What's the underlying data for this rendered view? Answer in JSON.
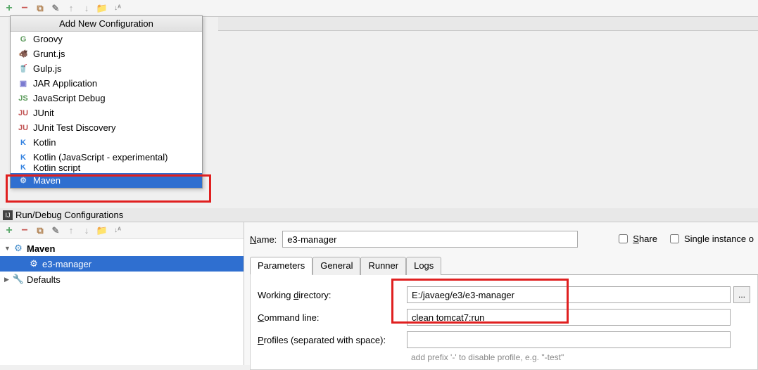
{
  "topToolbar": {
    "add": "+",
    "remove": "−",
    "copy": "⧉",
    "wrench": "✎",
    "up": "↑",
    "down": "↓",
    "folder": "📁",
    "sort": "↓ᴬ"
  },
  "dropdown": {
    "header": "Add New Configuration",
    "items": [
      {
        "icon": "G",
        "cls": "icon-g",
        "label": "Groovy"
      },
      {
        "icon": "🐗",
        "cls": "icon-grunt",
        "label": "Grunt.js"
      },
      {
        "icon": "🥤",
        "cls": "icon-gulp",
        "label": "Gulp.js"
      },
      {
        "icon": "▣",
        "cls": "icon-jar",
        "label": "JAR Application"
      },
      {
        "icon": "JS",
        "cls": "icon-js",
        "label": "JavaScript Debug"
      },
      {
        "icon": "JU",
        "cls": "icon-junit",
        "label": "JUnit"
      },
      {
        "icon": "JU",
        "cls": "icon-junit",
        "label": "JUnit Test Discovery"
      },
      {
        "icon": "K",
        "cls": "icon-k",
        "label": "Kotlin"
      },
      {
        "icon": "K",
        "cls": "icon-k",
        "label": "Kotlin (JavaScript - experimental)"
      },
      {
        "icon": "K",
        "cls": "icon-k",
        "label": "Kotlin script",
        "cutoff": true
      },
      {
        "icon": "⚙",
        "cls": "icon-maven",
        "label": "Maven",
        "selected": true
      }
    ]
  },
  "panelTitle": "Run/Debug Configurations",
  "tree": {
    "maven": "Maven",
    "child": "e3-manager",
    "defaults": "Defaults"
  },
  "form": {
    "nameLabel": "Name:",
    "nameValue": "e3-manager",
    "share": "Share",
    "single": "Single instance o",
    "tabs": [
      "Parameters",
      "General",
      "Runner",
      "Logs"
    ],
    "workdirLabel": "Working directory:",
    "workdirValue": "E:/javaeg/e3/e3-manager",
    "cmdLabel": "Command line:",
    "cmdValue": "clean tomcat7:run",
    "profilesLabel": "Profiles (separated with space):",
    "profilesValue": "",
    "hint": "add prefix '-' to disable profile, e.g. \"-test\"",
    "underlines": {
      "N": "N",
      "d": "d",
      "C": "C",
      "P": "P",
      "S": "S"
    }
  }
}
